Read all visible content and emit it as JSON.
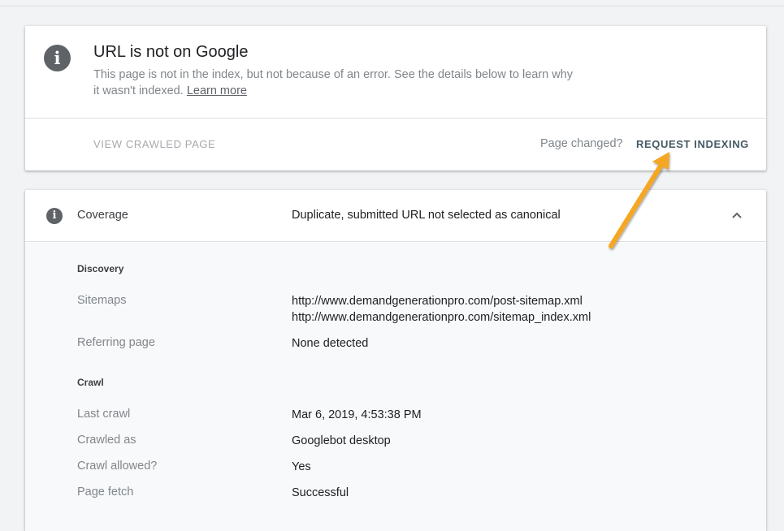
{
  "status": {
    "title": "URL is not on Google",
    "description": "This page is not in the index, but not because of an error. See the details below to learn why it wasn't indexed.",
    "learn_more": "Learn more",
    "view_crawled": "VIEW CRAWLED PAGE",
    "page_changed": "Page changed?",
    "request_indexing": "REQUEST INDEXING",
    "icon": "info-icon"
  },
  "coverage": {
    "label": "Coverage",
    "value": "Duplicate, submitted URL not selected as canonical",
    "discovery": {
      "heading": "Discovery",
      "sitemaps_label": "Sitemaps",
      "sitemaps": [
        "http://www.demandgenerationpro.com/post-sitemap.xml",
        "http://www.demandgenerationpro.com/sitemap_index.xml"
      ],
      "referring_label": "Referring page",
      "referring_value": "None detected"
    },
    "crawl": {
      "heading": "Crawl",
      "rows": [
        {
          "label": "Last crawl",
          "value": "Mar 6, 2019, 4:53:38 PM"
        },
        {
          "label": "Crawled as",
          "value": "Googlebot desktop"
        },
        {
          "label": "Crawl allowed?",
          "value": "Yes"
        },
        {
          "label": "Page fetch",
          "value": "Successful"
        }
      ]
    }
  },
  "colors": {
    "arrow": "#f5a623",
    "accent": "#455a64",
    "icon": "#5f6368"
  }
}
